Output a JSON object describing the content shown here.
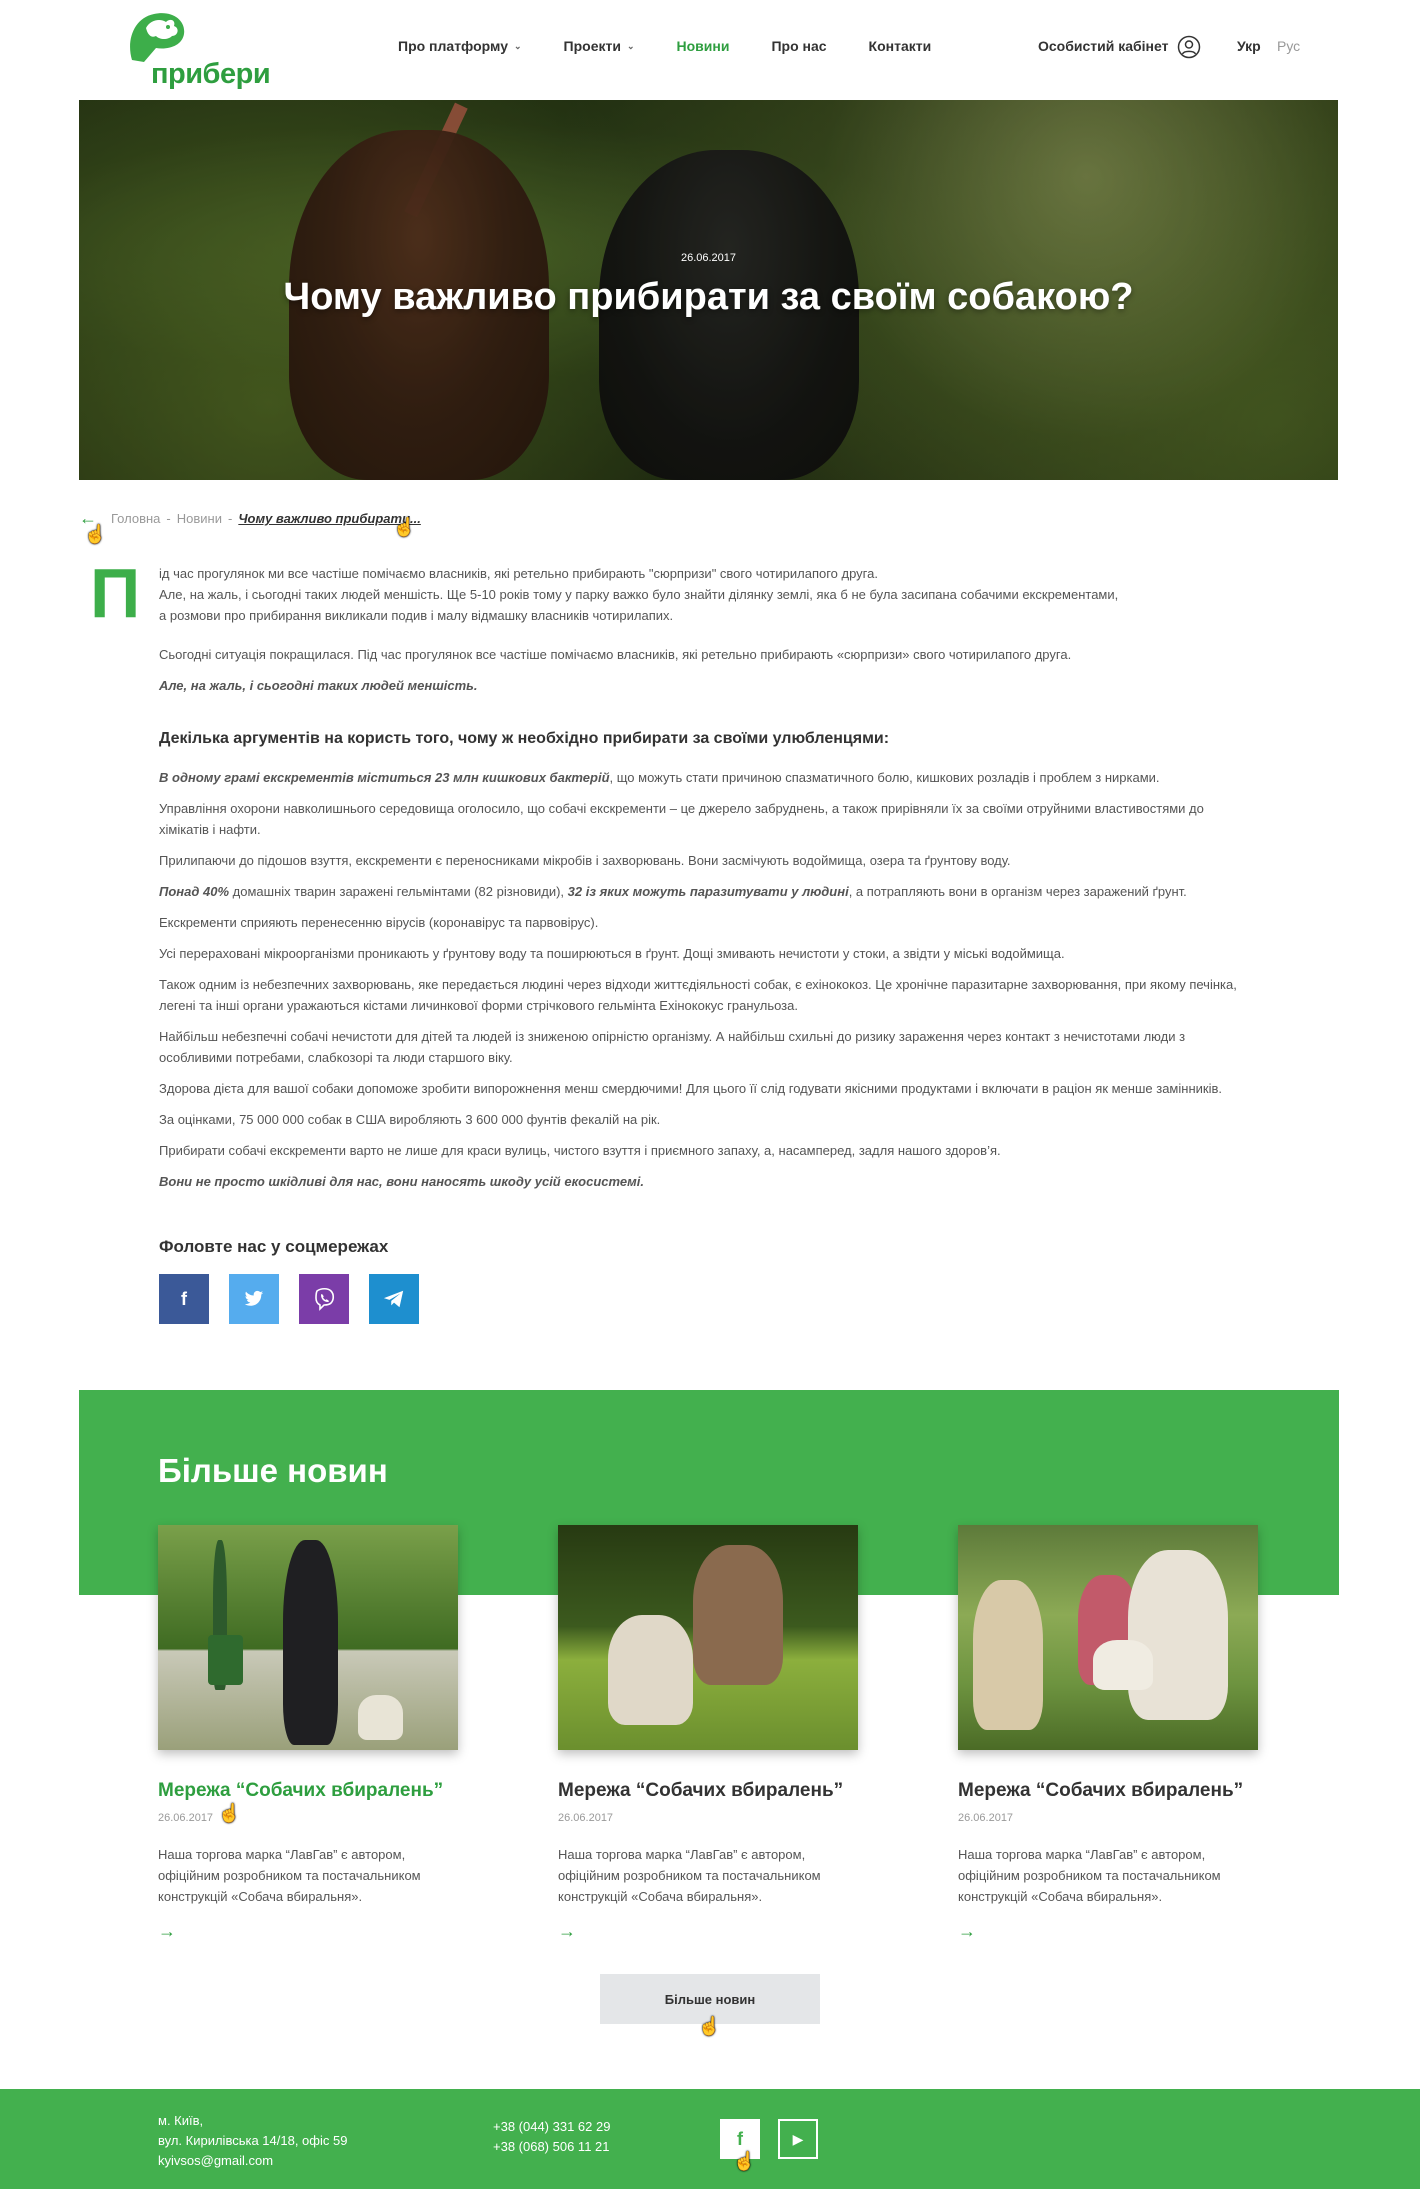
{
  "header": {
    "logo_text": "прибери",
    "nav": [
      {
        "label": "Про платформу",
        "has_caret": true
      },
      {
        "label": "Проекти",
        "has_caret": true
      },
      {
        "label": "Новини",
        "has_caret": false,
        "active": true
      },
      {
        "label": "Про нас",
        "has_caret": false
      },
      {
        "label": "Контакти",
        "has_caret": false
      }
    ],
    "cabinet": "Особистий кабінет",
    "lang_ukr": "Укр",
    "lang_rus": "Рус"
  },
  "hero": {
    "date": "26.06.2017",
    "title": "Чому важливо прибирати за своїм собакою?"
  },
  "breadcrumb": {
    "home": "Головна",
    "news": "Новини",
    "sep": "-",
    "current": "Чому важливо прибирати..."
  },
  "article": {
    "dropcap": "П",
    "intro1": "ід час прогулянок ми все частіше помічаємо власників, які ретельно прибирають \"сюрпризи\" свого чотирилапого друга.",
    "intro2": "Але, на    жаль, і сьогодні таких людей меншість. Ще 5-10 років тому у парку важко було знайти ділянку землі, яка б не була засипана собачими екскрементами,",
    "intro3": "а розмови про прибирання викликали подив і малу відмашку власників чотирилапих.",
    "p1": "Сьогодні ситуація покращилася. Під час прогулянок все частіше помічаємо власників,  які ретельно прибирають «сюрпризи» свого чотирилапого друга.",
    "p2": "Але, на жаль, і сьогодні таких людей меншість.",
    "heading": "Декілька аргументів на користь того, чому ж необхідно прибирати за своїми улюбленцями:",
    "b1_em": "В одному грамі екскрементів міститься 23 млн кишкових бактерій",
    "b1_rest": ", що можуть стати причиною спазматичного болю, кишкових розладів і проблем з нирками.",
    "b2": "Управління охорони навколишнього середовища оголосило, що собачі екскременти – це джерело забруднень, а також прирівняли їх за своїми отруйними властивостями до хімікатів і нафти.",
    "b3": "Прилипаючи до підошов взуття, екскременти є переносниками мікробів і захворювань. Вони засмічують водоймища, озера та ґрунтову воду.",
    "b4_em1": "Понад 40%",
    "b4_mid": " домашніх тварин заражені гельмінтами (82 різновиди), ",
    "b4_em2": "32 із яких можуть паразитувати у людині",
    "b4_rest": ", а потрапляють вони в організм через заражений ґрунт.",
    "b5": "Екскременти сприяють перенесенню вірусів (коронавірус та парвовірус).",
    "b6": "Усі перераховані мікроорганізми проникають у ґрунтову воду та поширюються в ґрунт. Дощі змивають нечистоти у стоки, а звідти у міські водоймища.",
    "b7": "Також одним із небезпечних захворювань, яке передається людині через відходи життєдіяльності собак, є ехінококоз. Це хронічне паразитарне захворювання, при якому печінка, легені та інші органи уражаються кістами личинкової форми стрічкового гельмінта Ехінококус гранульоза.",
    "b8": "Найбільш небезпечні собачі нечистоти для дітей та людей із зниженою опірністю організму. А найбільш схильні до ризику зараження через контакт з нечистотами люди з особливими потребами, слабкозорі та люди старшого віку.",
    "b9": "Здорова дієта для вашої собаки допоможе зробити випорожнення менш смердючими! Для цього її слід годувати якісними продуктами і включати в раціон як менше замінників.",
    "b10": "За оцінками, 75 000 000 собак в США виробляють 3 600 000 фунтів фекалій на рік.",
    "b11": "Прибирати собачі екскременти варто не лише для краси вулиць, чистого взуття і приємного запаху, а, насамперед, задля нашого здоров’я.",
    "b12_em": "Вони не просто шкідливі для нас, вони наносять шкоду усій екосистемі."
  },
  "social": {
    "title": "Фоловте нас у соцмережах",
    "items": [
      {
        "name": "facebook",
        "glyph": "f"
      },
      {
        "name": "twitter",
        "glyph": "🐦"
      },
      {
        "name": "viber",
        "glyph": "✆"
      },
      {
        "name": "telegram",
        "glyph": "➤"
      }
    ]
  },
  "more_news": {
    "title": "Більше новин",
    "cards": [
      {
        "title": "Мережа “Собачих вбиралень”",
        "date": "26.06.2017",
        "text": "Наша торгова марка “ЛавГав” є автором, офіційним розробником та постачальником конструкцій «Собача вбиральня».",
        "arrow": "→"
      },
      {
        "title": "Мережа “Собачих вбиралень”",
        "date": "26.06.2017",
        "text": "Наша торгова марка “ЛавГав” є автором, офіційним розробником та постачальником конструкцій «Собача вбиральня».",
        "arrow": "→"
      },
      {
        "title": "Мережа “Собачих вбиралень”",
        "date": "26.06.2017",
        "text": "Наша торгова марка “ЛавГав” є автором, офіційним розробником та постачальником конструкцій «Собача вбиральня».",
        "arrow": "→"
      }
    ],
    "button": "Більше новин"
  },
  "footer": {
    "city": "м. Київ,",
    "street": "вул. Кирилівська 14/18, офіс 59",
    "email": "kyivsos@gmail.com",
    "phone1": "+38 (044) 331 62 29",
    "phone2": "+38 (068) 506 11 21"
  },
  "colors": {
    "brand_green": "#43b04e",
    "link_green": "#2e9e3f",
    "facebook": "#3b5998",
    "twitter": "#55acee",
    "viber": "#7b3da8",
    "telegram": "#1e8fcf"
  }
}
